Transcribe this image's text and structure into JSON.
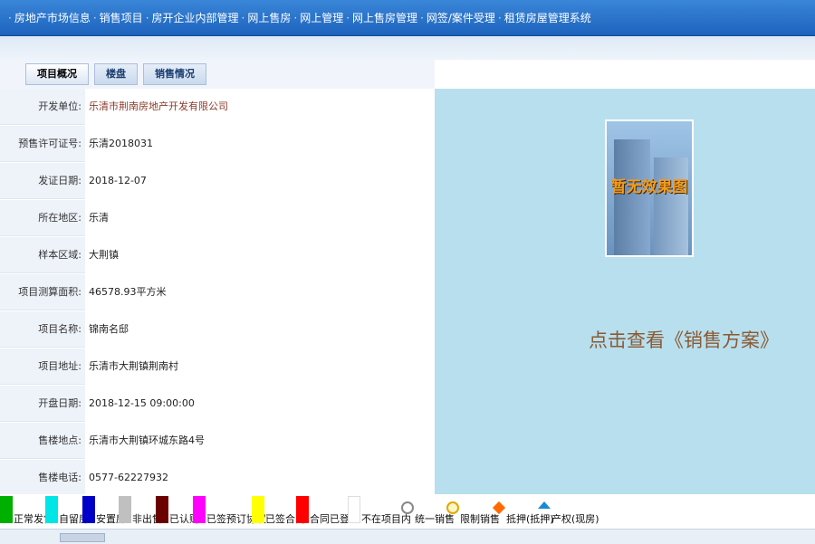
{
  "nav": {
    "items": [
      "房地产市场信息",
      "销售项目",
      "房开企业内部管理",
      "网上售房",
      "网上管理",
      "网上售房管理",
      "网签/案件受理",
      "租赁房屋管理系统"
    ]
  },
  "tabs": [
    {
      "label": "项目概况"
    },
    {
      "label": "楼盘"
    },
    {
      "label": "销售情况"
    }
  ],
  "info": {
    "rows": [
      {
        "label": "开发单位:",
        "value": "乐清市荆南房地产开发有限公司"
      },
      {
        "label": "预售许可证号:",
        "value": "乐清2018031"
      },
      {
        "label": "发证日期:",
        "value": "2018-12-07"
      },
      {
        "label": "所在地区:",
        "value": "乐清"
      },
      {
        "label": "样本区域:",
        "value": "大荆镇"
      },
      {
        "label": "项目测算面积:",
        "value": "46578.93平方米"
      },
      {
        "label": "项目名称:",
        "value": "锦南名邸"
      },
      {
        "label": "项目地址:",
        "value": "乐清市大荆镇荆南村"
      },
      {
        "label": "开盘日期:",
        "value": "2018-12-15 09:00:00"
      },
      {
        "label": "售楼地点:",
        "value": "乐清市大荆镇环城东路4号"
      },
      {
        "label": "售楼电话:",
        "value": "0577-62227932"
      }
    ]
  },
  "preview": {
    "photo_caption": "暂无效果图",
    "sales_link": "点击查看《销售方案》"
  },
  "legend": [
    {
      "label": "正常发售",
      "color": "#00b000"
    },
    {
      "label": "自留房",
      "color": "#00e5e5"
    },
    {
      "label": "安置房",
      "color": "#0000c8"
    },
    {
      "label": "非出售",
      "color": "#c0c0c0"
    },
    {
      "label": "已认购",
      "color": "#6b0000"
    },
    {
      "label": "已签预订协议",
      "color": "#ff00ff"
    },
    {
      "label": "已签合同",
      "color": "#ffff00"
    },
    {
      "label": "合同已登记",
      "color": "#ff0000"
    },
    {
      "label": "不在项目内",
      "color": "#ffffff"
    },
    {
      "label": "统一销售",
      "icon": "circle-letter-icon"
    },
    {
      "label": "限制销售",
      "icon": "circle-minus-icon"
    },
    {
      "label": "抵押(抵押)",
      "icon": "diamond-icon"
    },
    {
      "label": "产权(现房)",
      "icon": "house-icon"
    }
  ]
}
